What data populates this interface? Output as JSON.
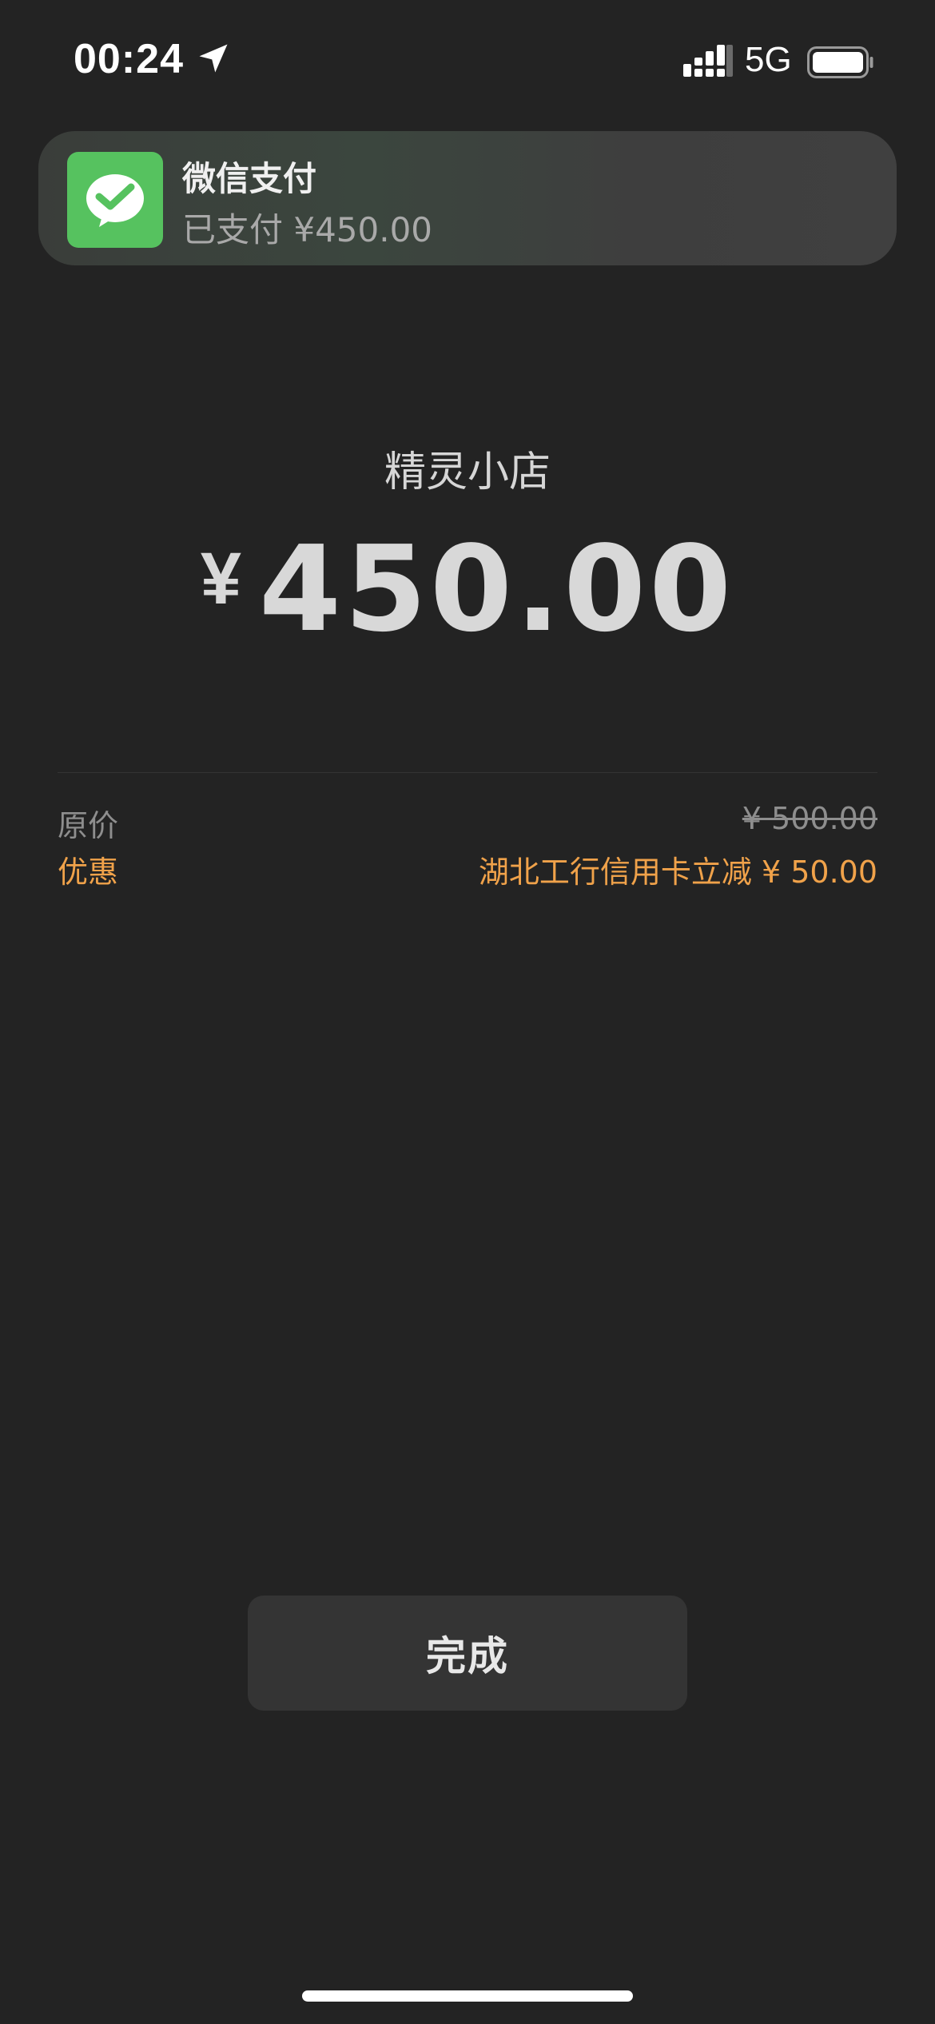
{
  "status_bar": {
    "time": "00:24",
    "network": "5G",
    "icons": [
      "location-arrow-icon",
      "signal-icon",
      "battery-icon"
    ]
  },
  "notification": {
    "app_icon": "wechat-pay-icon",
    "title": "微信支付",
    "body": "已支付 ¥450.00"
  },
  "payment": {
    "merchant": "精灵小店",
    "currency_symbol": "¥",
    "amount": "450.00"
  },
  "details": {
    "original_label": "原价",
    "original_value": "¥ 500.00",
    "discount_label": "优惠",
    "discount_value": "湖北工行信用卡立减 ¥ 50.00"
  },
  "actions": {
    "done_label": "完成"
  },
  "colors": {
    "background": "#232323",
    "accent_orange": "#f0a24a",
    "wechat_green": "#56c25f",
    "button_bg": "#343434"
  }
}
